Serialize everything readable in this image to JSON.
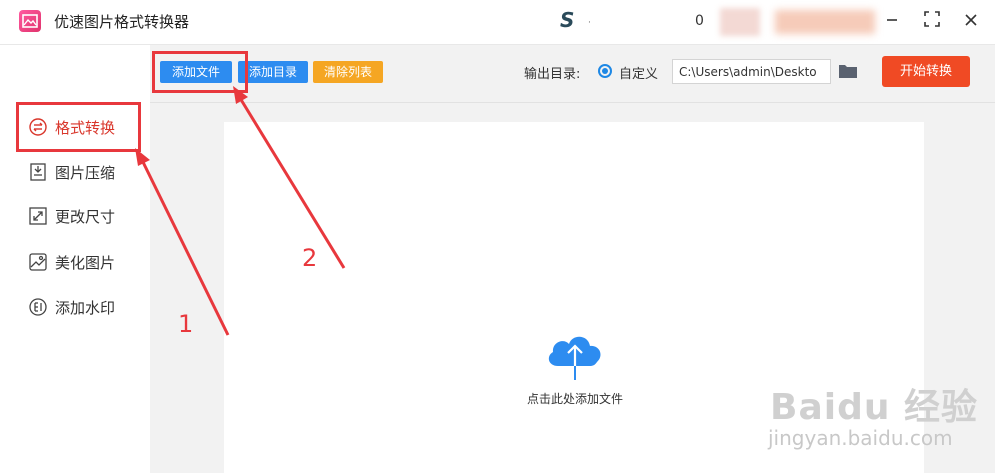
{
  "app": {
    "title": "优速图片格式转换器",
    "title_s": "S",
    "title_dot": "·",
    "title_zero": "0"
  },
  "window_controls": {
    "minimize_icon": "minus-icon",
    "maximize_icon": "expand-icon",
    "close_icon": "close-icon"
  },
  "sidebar": {
    "items": [
      {
        "label": "格式转换",
        "icon": "swap-icon",
        "active": true
      },
      {
        "label": "图片压缩",
        "icon": "compress-icon",
        "active": false
      },
      {
        "label": "更改尺寸",
        "icon": "resize-icon",
        "active": false
      },
      {
        "label": "美化图片",
        "icon": "beautify-icon",
        "active": false
      },
      {
        "label": "添加水印",
        "icon": "watermark-icon",
        "active": false
      }
    ]
  },
  "toolbar": {
    "add_file": "添加文件",
    "add_folder": "添加目录",
    "clear_list": "清除列表",
    "output_label": "输出目录:",
    "custom_option": "自定义",
    "output_path": "C:\\Users\\admin\\Deskto",
    "start": "开始转换"
  },
  "drop_area": {
    "hint": "点击此处添加文件",
    "icon": "cloud-upload-icon"
  },
  "annotations": {
    "step1": "1",
    "step2": "2"
  },
  "watermark": {
    "logo": "Baidu 经验",
    "url": "jingyan.baidu.com"
  },
  "colors": {
    "accent_blue": "#2d8cf0",
    "orange": "#f5a623",
    "start_red": "#f04a24",
    "annotation_red": "#e8383d",
    "active_red": "#d9362b"
  }
}
